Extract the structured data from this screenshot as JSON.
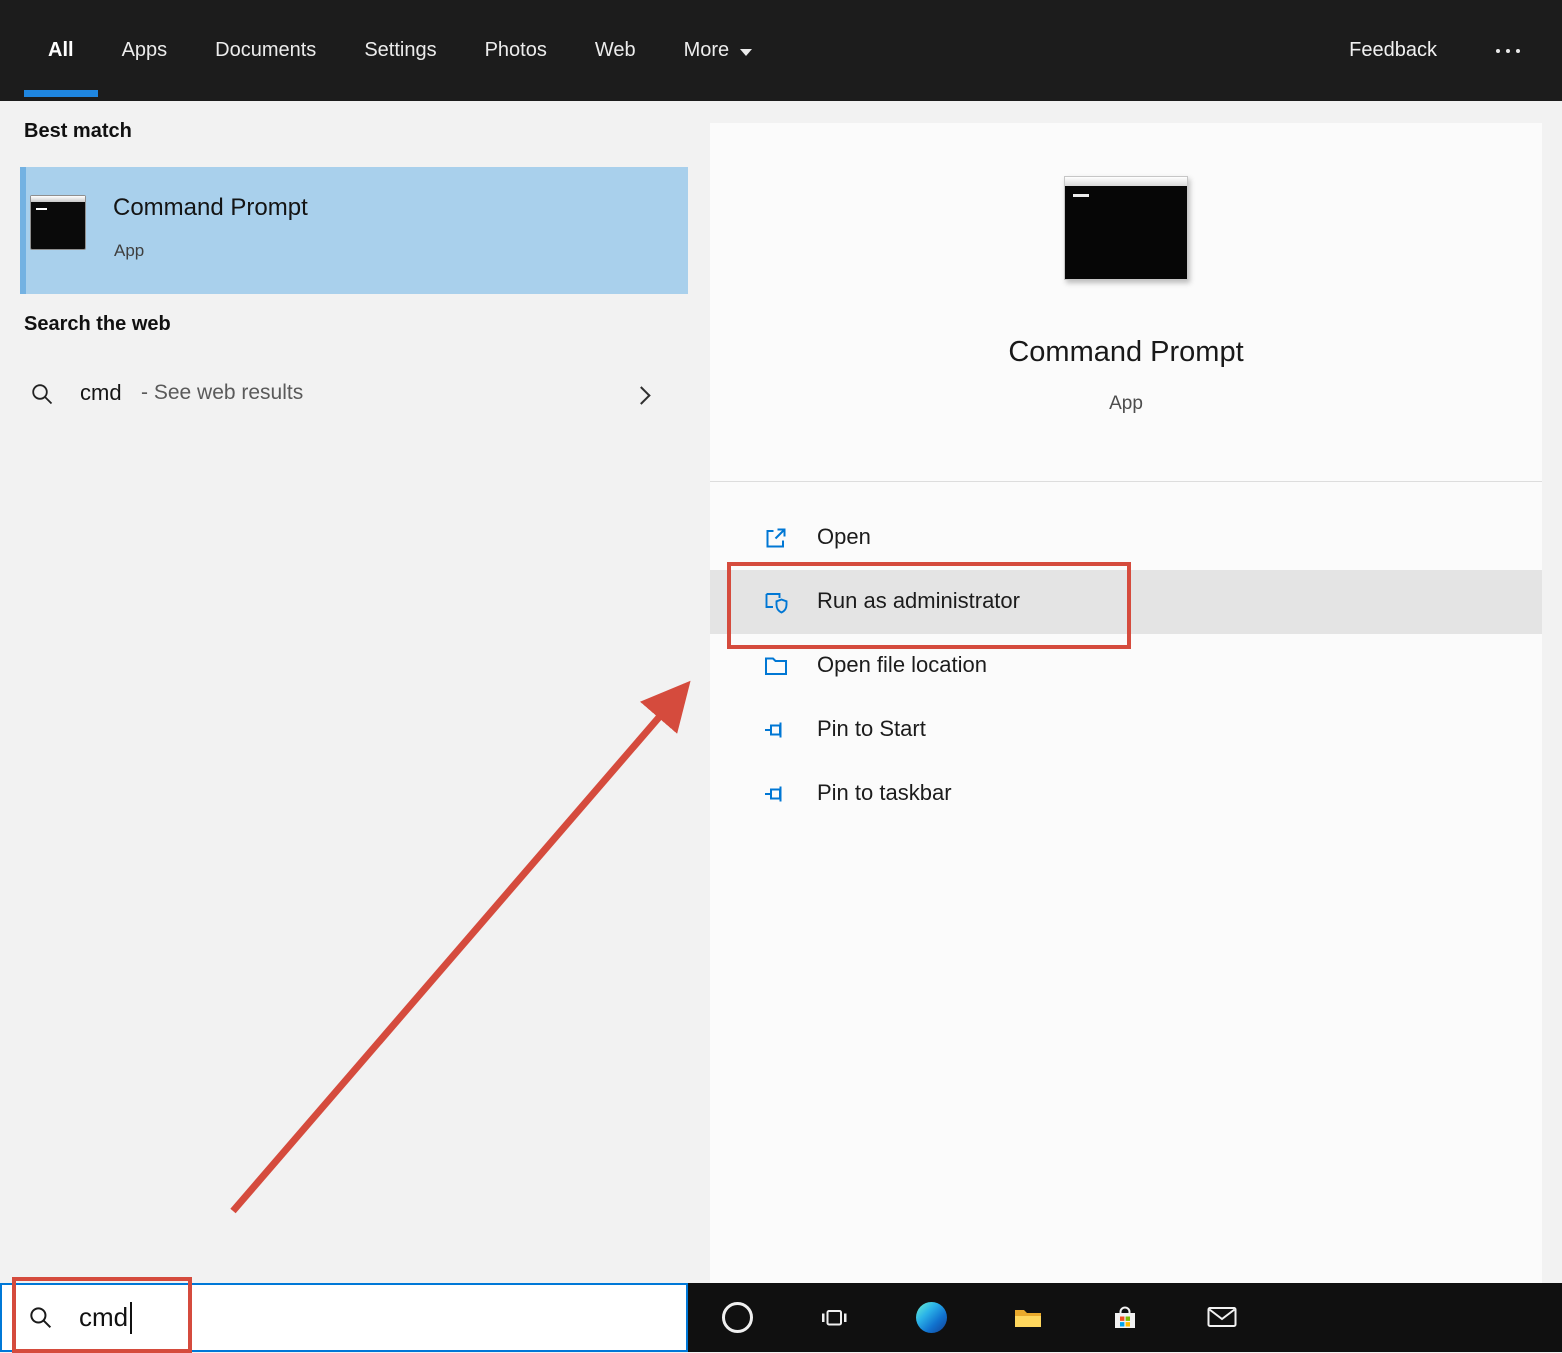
{
  "colors": {
    "accent_blue": "#0078d7",
    "selection_blue": "#a9d0ec",
    "link_blue": "#0077d4",
    "annotation_red": "#d54b3d",
    "topbar_dark": "#1c1c1c"
  },
  "topnav": {
    "tabs": [
      {
        "label": "All",
        "active": true
      },
      {
        "label": "Apps",
        "active": false
      },
      {
        "label": "Documents",
        "active": false
      },
      {
        "label": "Settings",
        "active": false
      },
      {
        "label": "Photos",
        "active": false
      },
      {
        "label": "Web",
        "active": false
      },
      {
        "label": "More",
        "active": false,
        "icon": "chevron-down-icon"
      }
    ],
    "feedback": "Feedback",
    "more_options_icon": "ellipsis-icon"
  },
  "left_panel": {
    "best_match_header": "Best match",
    "best_match": {
      "title": "Command Prompt",
      "subtitle": "App",
      "icon": "command-prompt-icon"
    },
    "web_header": "Search the web",
    "web_result": {
      "query": "cmd",
      "suffix": "- See web results",
      "icon": "search-icon"
    }
  },
  "search_box": {
    "value": "cmd",
    "icon": "search-icon"
  },
  "preview": {
    "title": "Command Prompt",
    "subtitle": "App",
    "icon": "command-prompt-icon",
    "actions": [
      {
        "label": "Open",
        "icon": "open-icon",
        "highlighted": false
      },
      {
        "label": "Run as administrator",
        "icon": "admin-shield-icon",
        "highlighted": true
      },
      {
        "label": "Open file location",
        "icon": "folder-icon",
        "highlighted": false
      },
      {
        "label": "Pin to Start",
        "icon": "pin-icon",
        "highlighted": false
      },
      {
        "label": "Pin to taskbar",
        "icon": "pin-icon",
        "highlighted": false
      }
    ]
  },
  "taskbar": {
    "icons": [
      "cortana-icon",
      "task-view-icon",
      "edge-icon",
      "file-explorer-icon",
      "store-icon",
      "mail-icon"
    ]
  }
}
